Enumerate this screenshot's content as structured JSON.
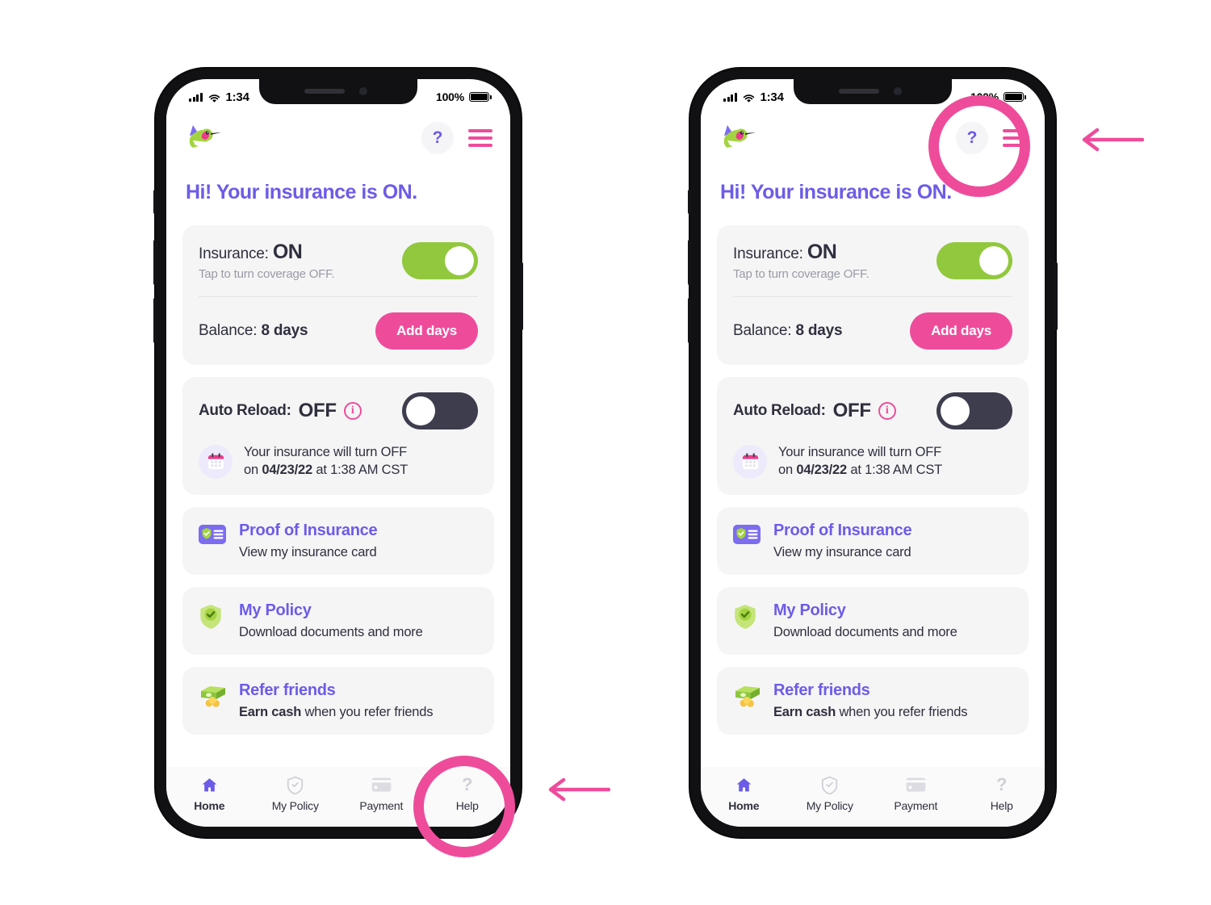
{
  "brand": {
    "accent_pink": "#EE4C9B",
    "accent_purple": "#6C5CE7",
    "accent_green": "#92C83D",
    "dark": "#3d3d4e",
    "card_bg": "#f5f5f6",
    "logo_name": "hummingbird-logo"
  },
  "status_bar": {
    "time": "1:34",
    "battery_percent": "100%",
    "signal_icon": "cellular-signal-icon",
    "wifi_icon": "wifi-icon",
    "battery_icon": "battery-full-icon"
  },
  "header": {
    "help_label": "?",
    "help_icon": "question-mark-icon",
    "menu_icon": "hamburger-menu-icon"
  },
  "main": {
    "greeting": "Hi! Your insurance is ON.",
    "insurance_card": {
      "label": "Insurance:",
      "value": "ON",
      "subtitle": "Tap to turn coverage OFF.",
      "toggle_state": "on",
      "balance_label": "Balance:",
      "balance_value": "8 days",
      "add_days_label": "Add days"
    },
    "auto_reload_card": {
      "label": "Auto Reload:",
      "value": "OFF",
      "info_icon": "info-circle-icon",
      "toggle_state": "off",
      "calendar_icon": "calendar-icon",
      "notice_line1": "Your insurance will turn OFF",
      "notice_prefix": "on ",
      "notice_date": "04/23/22",
      "notice_suffix": " at 1:38 AM CST"
    },
    "links": [
      {
        "icon": "insurance-card-icon",
        "title": "Proof of Insurance",
        "subtitle": "View my insurance card"
      },
      {
        "icon": "shield-check-icon",
        "title": "My Policy",
        "subtitle": "Download documents and more"
      },
      {
        "icon": "money-cash-icon",
        "title": "Refer friends",
        "subtitle_bold": "Earn cash",
        "subtitle_rest": " when you refer friends"
      }
    ]
  },
  "tabbar": {
    "items": [
      {
        "label": "Home",
        "icon": "home-icon",
        "active": true
      },
      {
        "label": "My Policy",
        "icon": "shield-check-icon",
        "active": false
      },
      {
        "label": "Payment",
        "icon": "credit-card-icon",
        "active": false
      },
      {
        "label": "Help",
        "icon": "question-mark-icon",
        "active": false
      }
    ]
  },
  "annotations": {
    "color": "#EE4C9B",
    "left_highlight_target": "Help tab",
    "right_highlight_target": "Help question-mark button",
    "arrow_icon": "left-arrow-icon"
  }
}
